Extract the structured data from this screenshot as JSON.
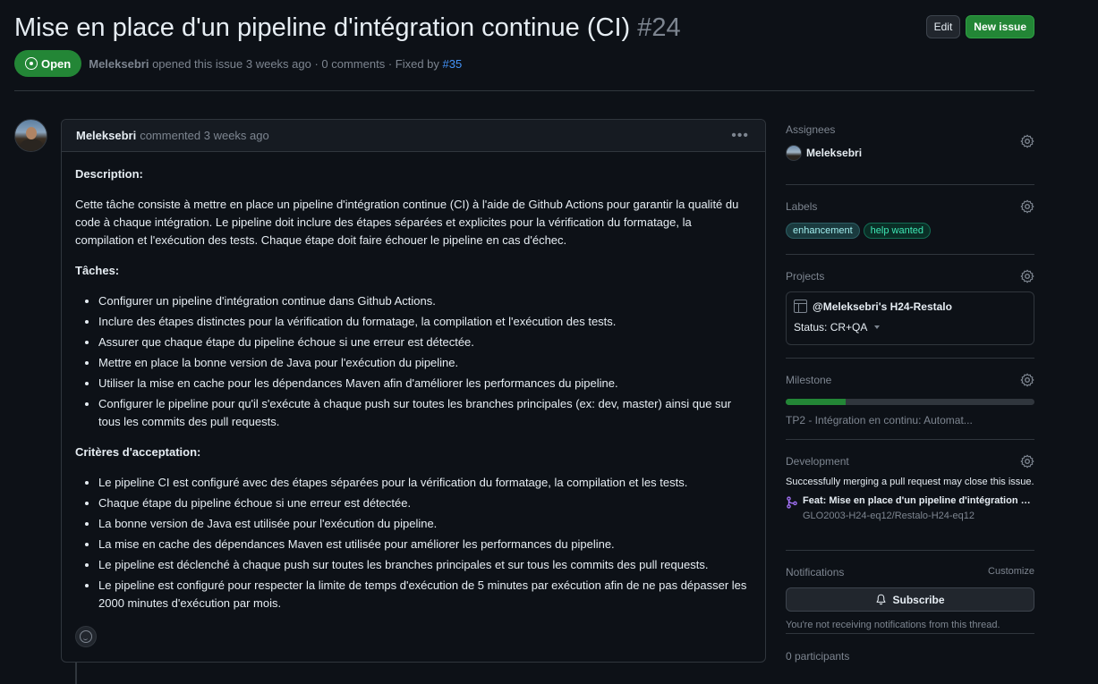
{
  "issue": {
    "title": "Mise en place d'un pipeline d'intégration continue (CI)",
    "number": "#24",
    "state": "Open",
    "author": "Meleksebri",
    "meta_text": "opened this issue 3 weeks ago · 0 comments · Fixed by",
    "fixed_by": "#35"
  },
  "header_buttons": {
    "edit": "Edit",
    "new_issue": "New issue"
  },
  "comment": {
    "author": "Meleksebri",
    "time": "commented 3 weeks ago",
    "description_heading": "Description:",
    "description": "Cette tâche consiste à mettre en place un pipeline d'intégration continue (CI) à l'aide de Github Actions pour garantir la qualité du code à chaque intégration. Le pipeline doit inclure des étapes séparées et explicites pour la vérification du formatage, la compilation et l'exécution des tests. Chaque étape doit faire échouer le pipeline en cas d'échec.",
    "tasks_heading": "Tâches:",
    "tasks": [
      "Configurer un pipeline d'intégration continue dans Github Actions.",
      "Inclure des étapes distinctes pour la vérification du formatage, la compilation et l'exécution des tests.",
      "Assurer que chaque étape du pipeline échoue si une erreur est détectée.",
      "Mettre en place la bonne version de Java pour l'exécution du pipeline.",
      "Utiliser la mise en cache pour les dépendances Maven afin d'améliorer les performances du pipeline.",
      "Configurer le pipeline pour qu'il s'exécute à chaque push sur toutes les branches principales (ex: dev, master) ainsi que sur tous les commits des pull requests."
    ],
    "criteria_heading": "Critères d'acceptation:",
    "criteria": [
      "Le pipeline CI est configuré avec des étapes séparées pour la vérification du formatage, la compilation et les tests.",
      "Chaque étape du pipeline échoue si une erreur est détectée.",
      "La bonne version de Java est utilisée pour l'exécution du pipeline.",
      "La mise en cache des dépendances Maven est utilisée pour améliorer les performances du pipeline.",
      "Le pipeline est déclenché à chaque push sur toutes les branches principales et sur tous les commits des pull requests.",
      "Le pipeline est configuré pour respecter la limite de temps d'exécution de 5 minutes par exécution afin de ne pas dépasser les 2000 minutes d'exécution par mois."
    ]
  },
  "sidebar": {
    "assignees": {
      "title": "Assignees",
      "name": "Meleksebri"
    },
    "labels": {
      "title": "Labels",
      "items": [
        "enhancement",
        "help wanted"
      ]
    },
    "projects": {
      "title": "Projects",
      "name": "@Meleksebri's H24-Restalo",
      "status": "Status: CR+QA"
    },
    "milestone": {
      "title": "Milestone",
      "name": "TP2 - Intégration en continu: Automat...",
      "progress": 0.24
    },
    "development": {
      "title": "Development",
      "text": "Successfully merging a pull request may close this issue.",
      "pr_title": "Feat: Mise en place d'un pipeline d'intégration c...",
      "pr_repo": "GLO2003-H24-eq12/Restalo-H24-eq12"
    },
    "notifications": {
      "title": "Notifications",
      "customize": "Customize",
      "button": "Subscribe",
      "note": "You're not receiving notifications from this thread."
    },
    "participants": "0 participants"
  },
  "colors": {
    "open_green": "#238636",
    "link_blue": "#4493f8",
    "bg": "#0d1117"
  }
}
